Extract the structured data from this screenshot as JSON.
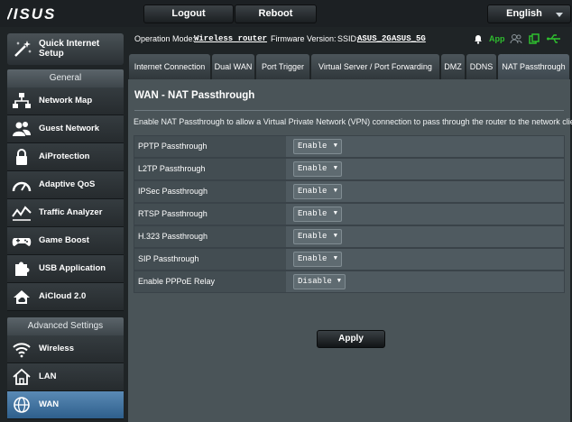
{
  "header": {
    "logo": "/ISUS",
    "logout_label": "Logout",
    "reboot_label": "Reboot",
    "language_label": "English"
  },
  "sidebar": {
    "quick_setup_label": "Quick Internet Setup",
    "general_title": "General",
    "general_items": [
      {
        "label": "Network Map",
        "icon": "network-map-icon"
      },
      {
        "label": "Guest Network",
        "icon": "guest-network-icon"
      },
      {
        "label": "AiProtection",
        "icon": "lock-icon"
      },
      {
        "label": "Adaptive QoS",
        "icon": "speedometer-icon"
      },
      {
        "label": "Traffic Analyzer",
        "icon": "traffic-chart-icon"
      },
      {
        "label": "Game Boost",
        "icon": "gamepad-icon"
      },
      {
        "label": "USB Application",
        "icon": "puzzle-icon"
      },
      {
        "label": "AiCloud 2.0",
        "icon": "cloud-home-icon"
      }
    ],
    "advanced_title": "Advanced Settings",
    "advanced_items": [
      {
        "label": "Wireless",
        "icon": "wifi-icon"
      },
      {
        "label": "LAN",
        "icon": "home-icon"
      },
      {
        "label": "WAN",
        "icon": "globe-icon",
        "active": true
      }
    ]
  },
  "status": {
    "mode_prefix": "Operation Mode:",
    "mode_value": "Wireless router",
    "firmware_label": "Firmware Version:",
    "ssid_label": "SSID:",
    "ssid_2g": "ASUS_2G",
    "ssid_5g": "ASUS_5G",
    "app_label": "App"
  },
  "tabs": [
    {
      "label": "Internet Connection"
    },
    {
      "label": "Dual WAN"
    },
    {
      "label": "Port Trigger"
    },
    {
      "label": "Virtual Server / Port Forwarding"
    },
    {
      "label": "DMZ"
    },
    {
      "label": "DDNS"
    },
    {
      "label": "NAT Passthrough",
      "active": true
    }
  ],
  "panel": {
    "title": "WAN - NAT Passthrough",
    "description": "Enable NAT Passthrough to allow a Virtual Private Network (VPN) connection to pass through the router to the network clients.",
    "rows": [
      {
        "label": "PPTP Passthrough",
        "value": "Enable"
      },
      {
        "label": "L2TP Passthrough",
        "value": "Enable"
      },
      {
        "label": "IPSec Passthrough",
        "value": "Enable"
      },
      {
        "label": "RTSP Passthrough",
        "value": "Enable"
      },
      {
        "label": "H.323 Passthrough",
        "value": "Enable"
      },
      {
        "label": "SIP Passthrough",
        "value": "Enable"
      },
      {
        "label": "Enable PPPoE Relay",
        "value": "Disable"
      }
    ],
    "apply_label": "Apply"
  },
  "colors": {
    "accent_green": "#2fbf2f",
    "active_nav": "#3f74a3",
    "panel_bg": "#4a5458"
  }
}
